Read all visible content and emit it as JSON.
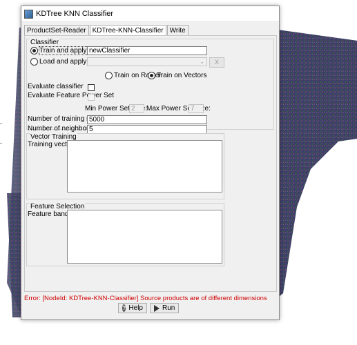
{
  "window": {
    "title": "KDTree KNN Classifier"
  },
  "tabs": [
    {
      "label": "ProductSet-Reader"
    },
    {
      "label": "KDTree-KNN-Classifier"
    },
    {
      "label": "Write"
    }
  ],
  "classifier": {
    "group_title": "Classifier",
    "train_label": "Train and apply classifier",
    "train_value": "newClassifier",
    "load_label": "Load and apply classifier",
    "load_value": "",
    "x_label": "X",
    "train_raster_label": "Train on Raster",
    "train_vectors_label": "Train on Vectors",
    "evaluate_label": "Evaluate classifier",
    "evaluate_fps_label": "Evaluate Feature Power Set",
    "min_power_label": "Min Power Set Size:",
    "min_power_value": "2",
    "max_power_label": "Max Power Set Size:",
    "max_power_value": "7",
    "num_samples_label": "Number of training samples",
    "num_samples_value": "5000",
    "num_neighbours_label": "Number of neighbours:",
    "num_neighbours_value": "5"
  },
  "vector_training": {
    "group_title": "Vector Training",
    "vectors_label": "Training vectors:"
  },
  "feature_selection": {
    "group_title": "Feature Selection",
    "bands_label": "Feature bands:"
  },
  "error_text": "Error: [NodeId: KDTree-KNN-Classifier] Source products are of different dimensions",
  "buttons": {
    "help": "Help",
    "help_glyph": "?",
    "run": "Run"
  },
  "colors": {
    "error": "#d00000",
    "window_bg": "#f0f0f0"
  }
}
